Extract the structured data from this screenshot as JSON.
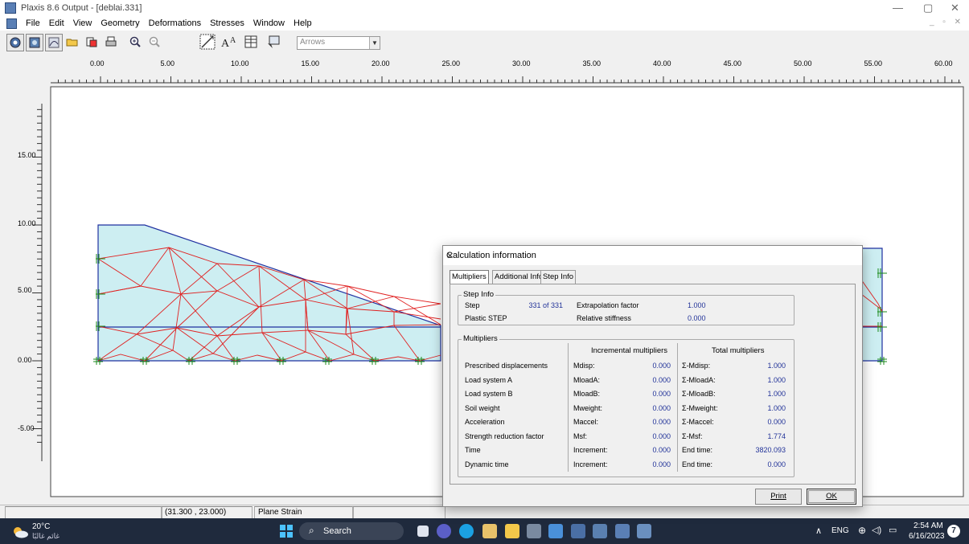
{
  "window": {
    "title": "Plaxis 8.6 Output - [deblai.331]",
    "controls": [
      "—",
      "▢",
      "✕"
    ]
  },
  "menu": [
    "File",
    "Edit",
    "View",
    "Geometry",
    "Deformations",
    "Stresses",
    "Window",
    "Help"
  ],
  "mdi_controls": "_ ▫ ✕",
  "toolbar": {
    "display_select_value": "Arrows"
  },
  "ruler_x": [
    "0.00",
    "5.00",
    "10.00",
    "15.00",
    "20.00",
    "25.00",
    "30.00",
    "35.00",
    "40.00",
    "45.00",
    "50.00",
    "55.00",
    "60.00"
  ],
  "ruler_y": [
    "15.00",
    "10.00",
    "5.00",
    "0.00",
    "-5.00"
  ],
  "status": {
    "coords": "(31.300 , 23.000)",
    "mode": "Plane Strain"
  },
  "dialog": {
    "title": "Calculation information",
    "close": "✕",
    "tabs": [
      "Multipliers",
      "Additional Info",
      "Step Info"
    ],
    "step_info": {
      "group_label": "Step Info",
      "step_label": "Step",
      "step_value": "331 of 331",
      "plastic_label": "Plastic STEP",
      "extrap_label": "Extrapolation factor",
      "extrap_value": "1.000",
      "stiff_label": "Relative stiffness",
      "stiff_value": "0.000"
    },
    "multipliers": {
      "group_label": "Multipliers",
      "incremental_header": "Incremental multipliers",
      "total_header": "Total multipliers",
      "rows": [
        {
          "name": "Prescribed displacements",
          "inc_label": "Mdisp:",
          "inc": "0.000",
          "tot_label": "Σ-Mdisp:",
          "tot": "1.000"
        },
        {
          "name": "Load system A",
          "inc_label": "MloadA:",
          "inc": "0.000",
          "tot_label": "Σ-MloadA:",
          "tot": "1.000"
        },
        {
          "name": "Load system B",
          "inc_label": "MloadB:",
          "inc": "0.000",
          "tot_label": "Σ-MloadB:",
          "tot": "1.000"
        },
        {
          "name": "Soil weight",
          "inc_label": "Mweight:",
          "inc": "0.000",
          "tot_label": "Σ-Mweight:",
          "tot": "1.000"
        },
        {
          "name": "Acceleration",
          "inc_label": "Maccel:",
          "inc": "0.000",
          "tot_label": "Σ-Maccel:",
          "tot": "0.000"
        },
        {
          "name": "Strength reduction factor",
          "inc_label": "Msf:",
          "inc": "0.000",
          "tot_label": "Σ-Msf:",
          "tot": "1.774"
        },
        {
          "name": "Time",
          "inc_label": "Increment:",
          "inc": "0.000",
          "tot_label": "End time:",
          "tot": "3820.093"
        },
        {
          "name": "Dynamic time",
          "inc_label": "Increment:",
          "inc": "0.000",
          "tot_label": "End time:",
          "tot": "0.000"
        }
      ]
    },
    "print_label": "Print",
    "ok_label": "OK"
  },
  "taskbar": {
    "weather_temp": "20°C",
    "weather_text": "غائم غالبًا",
    "search_label": "Search",
    "lang": "ENG",
    "time": "2:54 AM",
    "date": "6/16/2023",
    "notif_count": "7"
  },
  "colors": {
    "mesh_red": "#e02020",
    "geometry_blue": "#2030a0",
    "soil_fill": "#cdeef2",
    "fixity_green": "#1a8a1a"
  }
}
